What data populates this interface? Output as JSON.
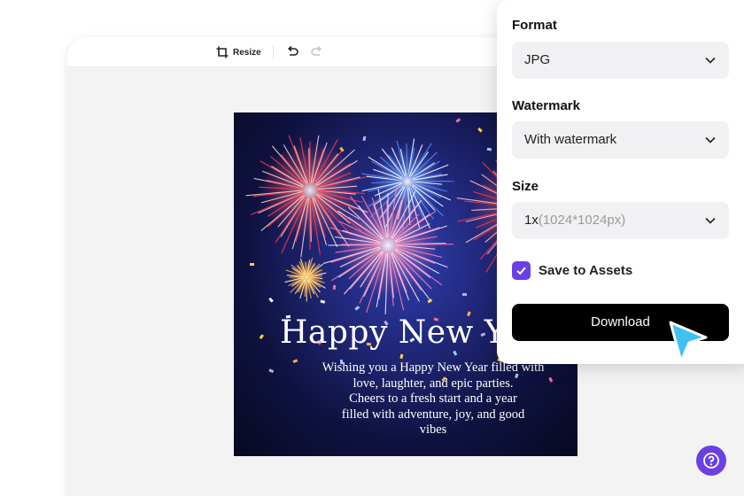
{
  "toolbar": {
    "resize_label": "Resize",
    "resize_icon": "crop-resize-icon",
    "undo_icon": "undo-icon",
    "redo_icon": "redo-icon"
  },
  "card": {
    "title": "Happy New Ye",
    "message_lines": [
      "Wishing you a Happy New Year filled with",
      "love, laughter, and epic parties.",
      "Cheers to a fresh start and a year",
      "filled with adventure, joy, and good",
      "vibes"
    ]
  },
  "export_panel": {
    "format": {
      "label": "Format",
      "value": "JPG"
    },
    "watermark": {
      "label": "Watermark",
      "value": "With watermark"
    },
    "size": {
      "label": "Size",
      "value": "1x",
      "detail": "(1024*1024px)"
    },
    "save_to_assets": {
      "label": "Save to Assets",
      "checked": true
    },
    "download_label": "Download"
  },
  "colors": {
    "accent": "#6a3fe6",
    "download_button": "#000000",
    "cursor": "#3fc1f0"
  },
  "help_icon": "help-icon"
}
